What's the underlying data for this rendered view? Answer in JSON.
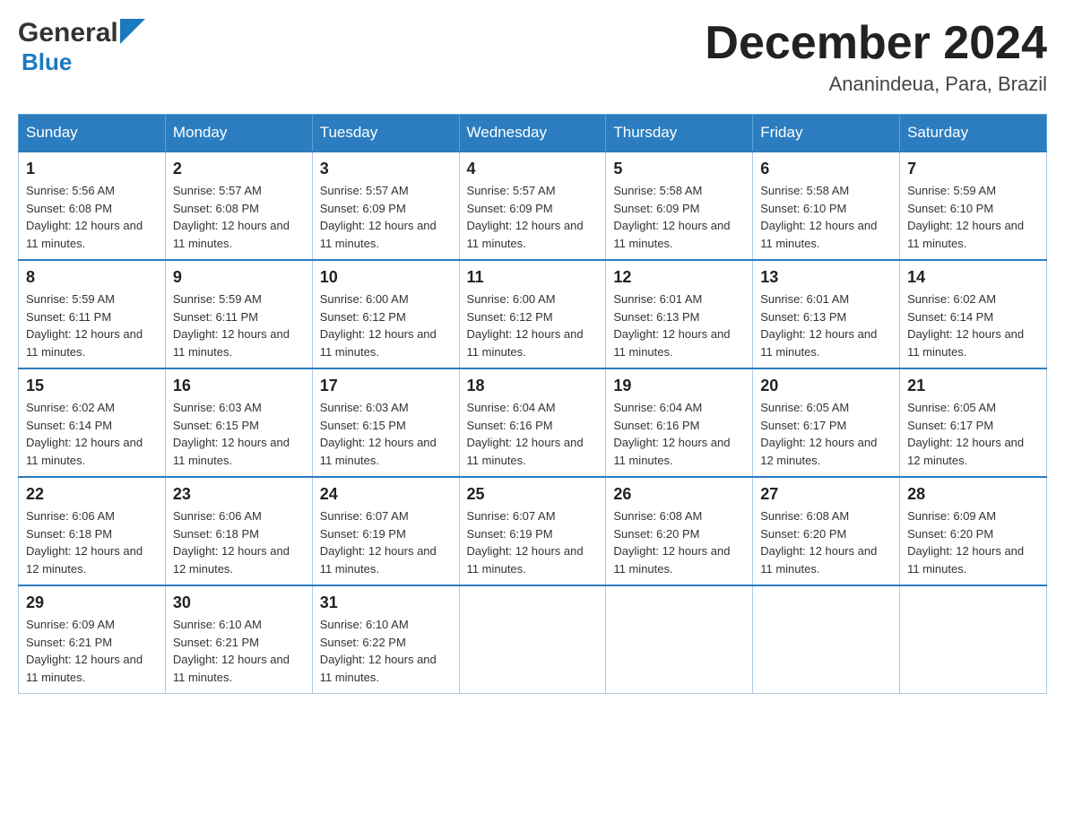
{
  "header": {
    "logo": {
      "general": "General",
      "blue": "Blue"
    },
    "title": "December 2024",
    "location": "Ananindeua, Para, Brazil"
  },
  "days_of_week": [
    "Sunday",
    "Monday",
    "Tuesday",
    "Wednesday",
    "Thursday",
    "Friday",
    "Saturday"
  ],
  "weeks": [
    [
      {
        "day": "1",
        "sunrise": "Sunrise: 5:56 AM",
        "sunset": "Sunset: 6:08 PM",
        "daylight": "Daylight: 12 hours and 11 minutes."
      },
      {
        "day": "2",
        "sunrise": "Sunrise: 5:57 AM",
        "sunset": "Sunset: 6:08 PM",
        "daylight": "Daylight: 12 hours and 11 minutes."
      },
      {
        "day": "3",
        "sunrise": "Sunrise: 5:57 AM",
        "sunset": "Sunset: 6:09 PM",
        "daylight": "Daylight: 12 hours and 11 minutes."
      },
      {
        "day": "4",
        "sunrise": "Sunrise: 5:57 AM",
        "sunset": "Sunset: 6:09 PM",
        "daylight": "Daylight: 12 hours and 11 minutes."
      },
      {
        "day": "5",
        "sunrise": "Sunrise: 5:58 AM",
        "sunset": "Sunset: 6:09 PM",
        "daylight": "Daylight: 12 hours and 11 minutes."
      },
      {
        "day": "6",
        "sunrise": "Sunrise: 5:58 AM",
        "sunset": "Sunset: 6:10 PM",
        "daylight": "Daylight: 12 hours and 11 minutes."
      },
      {
        "day": "7",
        "sunrise": "Sunrise: 5:59 AM",
        "sunset": "Sunset: 6:10 PM",
        "daylight": "Daylight: 12 hours and 11 minutes."
      }
    ],
    [
      {
        "day": "8",
        "sunrise": "Sunrise: 5:59 AM",
        "sunset": "Sunset: 6:11 PM",
        "daylight": "Daylight: 12 hours and 11 minutes."
      },
      {
        "day": "9",
        "sunrise": "Sunrise: 5:59 AM",
        "sunset": "Sunset: 6:11 PM",
        "daylight": "Daylight: 12 hours and 11 minutes."
      },
      {
        "day": "10",
        "sunrise": "Sunrise: 6:00 AM",
        "sunset": "Sunset: 6:12 PM",
        "daylight": "Daylight: 12 hours and 11 minutes."
      },
      {
        "day": "11",
        "sunrise": "Sunrise: 6:00 AM",
        "sunset": "Sunset: 6:12 PM",
        "daylight": "Daylight: 12 hours and 11 minutes."
      },
      {
        "day": "12",
        "sunrise": "Sunrise: 6:01 AM",
        "sunset": "Sunset: 6:13 PM",
        "daylight": "Daylight: 12 hours and 11 minutes."
      },
      {
        "day": "13",
        "sunrise": "Sunrise: 6:01 AM",
        "sunset": "Sunset: 6:13 PM",
        "daylight": "Daylight: 12 hours and 11 minutes."
      },
      {
        "day": "14",
        "sunrise": "Sunrise: 6:02 AM",
        "sunset": "Sunset: 6:14 PM",
        "daylight": "Daylight: 12 hours and 11 minutes."
      }
    ],
    [
      {
        "day": "15",
        "sunrise": "Sunrise: 6:02 AM",
        "sunset": "Sunset: 6:14 PM",
        "daylight": "Daylight: 12 hours and 11 minutes."
      },
      {
        "day": "16",
        "sunrise": "Sunrise: 6:03 AM",
        "sunset": "Sunset: 6:15 PM",
        "daylight": "Daylight: 12 hours and 11 minutes."
      },
      {
        "day": "17",
        "sunrise": "Sunrise: 6:03 AM",
        "sunset": "Sunset: 6:15 PM",
        "daylight": "Daylight: 12 hours and 11 minutes."
      },
      {
        "day": "18",
        "sunrise": "Sunrise: 6:04 AM",
        "sunset": "Sunset: 6:16 PM",
        "daylight": "Daylight: 12 hours and 11 minutes."
      },
      {
        "day": "19",
        "sunrise": "Sunrise: 6:04 AM",
        "sunset": "Sunset: 6:16 PM",
        "daylight": "Daylight: 12 hours and 11 minutes."
      },
      {
        "day": "20",
        "sunrise": "Sunrise: 6:05 AM",
        "sunset": "Sunset: 6:17 PM",
        "daylight": "Daylight: 12 hours and 12 minutes."
      },
      {
        "day": "21",
        "sunrise": "Sunrise: 6:05 AM",
        "sunset": "Sunset: 6:17 PM",
        "daylight": "Daylight: 12 hours and 12 minutes."
      }
    ],
    [
      {
        "day": "22",
        "sunrise": "Sunrise: 6:06 AM",
        "sunset": "Sunset: 6:18 PM",
        "daylight": "Daylight: 12 hours and 12 minutes."
      },
      {
        "day": "23",
        "sunrise": "Sunrise: 6:06 AM",
        "sunset": "Sunset: 6:18 PM",
        "daylight": "Daylight: 12 hours and 12 minutes."
      },
      {
        "day": "24",
        "sunrise": "Sunrise: 6:07 AM",
        "sunset": "Sunset: 6:19 PM",
        "daylight": "Daylight: 12 hours and 11 minutes."
      },
      {
        "day": "25",
        "sunrise": "Sunrise: 6:07 AM",
        "sunset": "Sunset: 6:19 PM",
        "daylight": "Daylight: 12 hours and 11 minutes."
      },
      {
        "day": "26",
        "sunrise": "Sunrise: 6:08 AM",
        "sunset": "Sunset: 6:20 PM",
        "daylight": "Daylight: 12 hours and 11 minutes."
      },
      {
        "day": "27",
        "sunrise": "Sunrise: 6:08 AM",
        "sunset": "Sunset: 6:20 PM",
        "daylight": "Daylight: 12 hours and 11 minutes."
      },
      {
        "day": "28",
        "sunrise": "Sunrise: 6:09 AM",
        "sunset": "Sunset: 6:20 PM",
        "daylight": "Daylight: 12 hours and 11 minutes."
      }
    ],
    [
      {
        "day": "29",
        "sunrise": "Sunrise: 6:09 AM",
        "sunset": "Sunset: 6:21 PM",
        "daylight": "Daylight: 12 hours and 11 minutes."
      },
      {
        "day": "30",
        "sunrise": "Sunrise: 6:10 AM",
        "sunset": "Sunset: 6:21 PM",
        "daylight": "Daylight: 12 hours and 11 minutes."
      },
      {
        "day": "31",
        "sunrise": "Sunrise: 6:10 AM",
        "sunset": "Sunset: 6:22 PM",
        "daylight": "Daylight: 12 hours and 11 minutes."
      },
      null,
      null,
      null,
      null
    ]
  ]
}
